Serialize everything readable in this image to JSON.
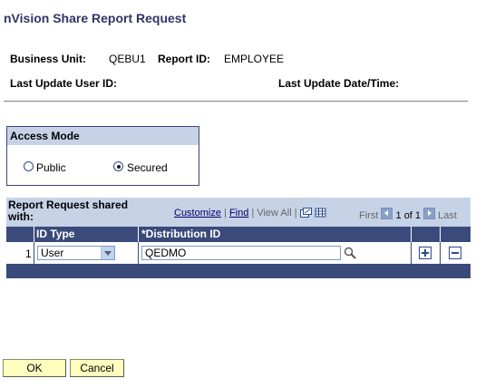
{
  "page": {
    "title": "nVision Share Report Request"
  },
  "header": {
    "business_unit_label": "Business Unit:",
    "business_unit_value": "QEBU1",
    "report_id_label": "Report ID:",
    "report_id_value": "EMPLOYEE",
    "last_update_user_label": "Last Update User ID:",
    "last_update_datetime_label": "Last Update Date/Time:"
  },
  "access_mode": {
    "title": "Access Mode",
    "options": [
      {
        "label": "Public",
        "selected": false
      },
      {
        "label": "Secured",
        "selected": true
      }
    ]
  },
  "grid": {
    "title": "Report Request shared with:",
    "customize": "Customize",
    "sep1": "|",
    "find": "Find",
    "sep2": "|",
    "view_all": "View All",
    "sep3": "|",
    "first": "First",
    "range": "1 of 1",
    "last": "Last",
    "columns": {
      "id_type": "ID Type",
      "distribution_id": "*Distribution ID"
    },
    "rows": [
      {
        "num": "1",
        "id_type": "User",
        "distribution_id": "QEDMO"
      }
    ]
  },
  "buttons": {
    "ok": "OK",
    "cancel": "Cancel"
  },
  "colors": {
    "grid_header_bg": "#3a4a7a",
    "light_header_bg": "#c6d3e7",
    "title_color": "#333366",
    "button_bg": "#ffffc0"
  }
}
